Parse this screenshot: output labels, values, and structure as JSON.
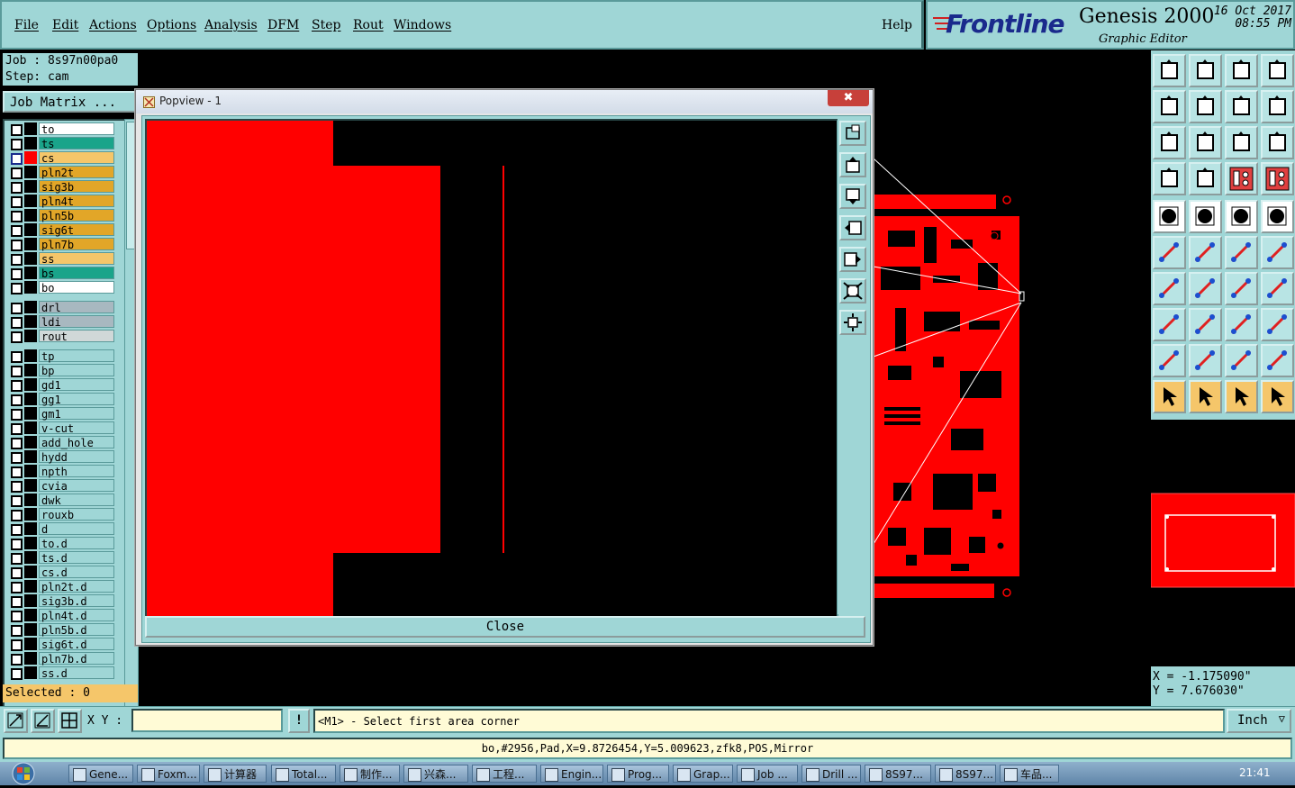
{
  "menu": [
    "File",
    "Edit",
    "Actions",
    "Options",
    "Analysis",
    "DFM",
    "Step",
    "Rout",
    "Windows"
  ],
  "help": "Help",
  "brand": {
    "logo": "Frontline",
    "title": "Genesis 2000",
    "subtitle": "Graphic Editor",
    "date": "16 Oct 2017",
    "time": "08:55 PM"
  },
  "job": {
    "job_line": "Job : 8s97n00pa0",
    "step_line": "Step: cam",
    "matrix_button": "Job Matrix ..."
  },
  "layers": [
    {
      "name": "to",
      "color": "#ffffff",
      "sym": "✎"
    },
    {
      "name": "ts",
      "color": "#1aa48a",
      "sym": ""
    },
    {
      "name": "cs",
      "color": "#f5c66a",
      "sym": "✎ ⊞",
      "active": true
    },
    {
      "name": "pln2t",
      "color": "#e2a628",
      "sym": "✎"
    },
    {
      "name": "sig3b",
      "color": "#e2a628",
      "sym": "✎"
    },
    {
      "name": "pln4t",
      "color": "#e2a628",
      "sym": "✎"
    },
    {
      "name": "pln5b",
      "color": "#e2a628",
      "sym": "✎"
    },
    {
      "name": "sig6t",
      "color": "#e2a628",
      "sym": "✎"
    },
    {
      "name": "pln7b",
      "color": "#e2a628",
      "sym": "✎"
    },
    {
      "name": "ss",
      "color": "#f5c66a",
      "sym": "✎"
    },
    {
      "name": "bs",
      "color": "#1aa48a",
      "sym": ""
    },
    {
      "name": "bo",
      "color": "#ffffff",
      "sym": ""
    },
    {
      "name": "drl",
      "color": "#a8b8c0",
      "sym": "",
      "gap": true
    },
    {
      "name": "ldi",
      "color": "#a8b8c0",
      "sym": ""
    },
    {
      "name": "rout",
      "color": "#d0d8d8",
      "sym": ""
    },
    {
      "name": "tp",
      "color": "#9fd6d6",
      "sym": "",
      "gap": true
    },
    {
      "name": "bp",
      "color": "#9fd6d6",
      "sym": ""
    },
    {
      "name": "gd1",
      "color": "#9fd6d6",
      "sym": "✎"
    },
    {
      "name": "gg1",
      "color": "#9fd6d6",
      "sym": ""
    },
    {
      "name": "gm1",
      "color": "#9fd6d6",
      "sym": "✎"
    },
    {
      "name": "v-cut",
      "color": "#9fd6d6",
      "sym": ""
    },
    {
      "name": "add_hole",
      "color": "#9fd6d6",
      "sym": ""
    },
    {
      "name": "hydd",
      "color": "#9fd6d6",
      "sym": ""
    },
    {
      "name": "npth",
      "color": "#9fd6d6",
      "sym": ""
    },
    {
      "name": "cvia",
      "color": "#9fd6d6",
      "sym": ""
    },
    {
      "name": "dwk",
      "color": "#9fd6d6",
      "sym": ""
    },
    {
      "name": "rouxb",
      "color": "#9fd6d6",
      "sym": ""
    },
    {
      "name": "d",
      "color": "#9fd6d6",
      "sym": ""
    },
    {
      "name": "to.d",
      "color": "#9fd6d6",
      "sym": "✎"
    },
    {
      "name": "ts.d",
      "color": "#9fd6d6",
      "sym": ""
    },
    {
      "name": "cs.d",
      "color": "#9fd6d6",
      "sym": "✎"
    },
    {
      "name": "pln2t.d",
      "color": "#9fd6d6",
      "sym": "✎"
    },
    {
      "name": "sig3b.d",
      "color": "#9fd6d6",
      "sym": "✎"
    },
    {
      "name": "pln4t.d",
      "color": "#9fd6d6",
      "sym": "✎"
    },
    {
      "name": "pln5b.d",
      "color": "#9fd6d6",
      "sym": "✎"
    },
    {
      "name": "sig6t.d",
      "color": "#9fd6d6",
      "sym": "✎"
    },
    {
      "name": "pln7b.d",
      "color": "#9fd6d6",
      "sym": "✎"
    },
    {
      "name": "ss.d",
      "color": "#9fd6d6",
      "sym": "✎"
    }
  ],
  "selected": "Selected : 0",
  "popview": {
    "title": "Popview - 1",
    "close_label": "Close",
    "close_x": "✖"
  },
  "coords": {
    "x": "X = -1.175090\"",
    "y": "Y = 7.676030\""
  },
  "xy_label": "X Y :",
  "exclaim": "!",
  "prompt": "<M1> - Select first area corner",
  "unit": "Inch",
  "status": "bo,#2956,Pad,X=9.8726454,Y=5.009623,zfk8,POS,Mirror",
  "taskbar": {
    "items": [
      "Gene...",
      "Foxm...",
      "计算器",
      "Total...",
      "制作...",
      "兴森...",
      "工程...",
      "Engin...",
      "Prog...",
      "Grap...",
      "Job ...",
      "Drill ...",
      "8S97...",
      "8S97...",
      "车品..."
    ],
    "clock": "21:41"
  },
  "colors": {
    "panel": "#9fd6d6",
    "copper": "#ff0000",
    "active_layer": "#f5c66a"
  }
}
